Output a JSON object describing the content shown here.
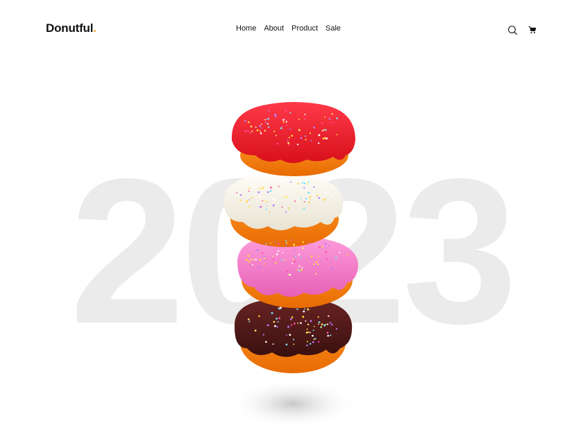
{
  "brand": {
    "name": "Donutful",
    "dot": ".",
    "dot_color": "#f2a51d"
  },
  "nav": {
    "items": [
      {
        "label": "Home"
      },
      {
        "label": "About"
      },
      {
        "label": "Product"
      },
      {
        "label": "Sale"
      }
    ]
  },
  "header_icons": [
    "search-icon",
    "cart-icon"
  ],
  "hero": {
    "year": "2023",
    "year_color": "#ebebeb"
  },
  "donuts": [
    {
      "flavor": "strawberry",
      "icing": "#ee1b2e"
    },
    {
      "flavor": "vanilla",
      "icing": "#f6f3e8"
    },
    {
      "flavor": "pink",
      "icing": "#f07ac6"
    },
    {
      "flavor": "chocolate",
      "icing": "#4a1716"
    }
  ]
}
